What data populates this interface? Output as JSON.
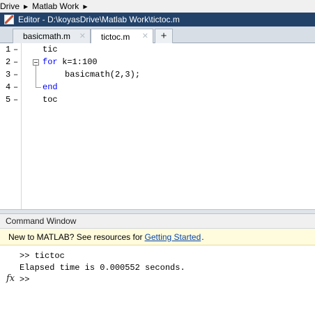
{
  "breadcrumb": {
    "items": [
      "Drive",
      "Matlab Work"
    ],
    "arrow": "▶"
  },
  "editor": {
    "title": "Editor - D:\\koyasDrive\\Matlab Work\\tictoc.m",
    "tabs": [
      {
        "label": "basicmath.m",
        "close": "✕"
      },
      {
        "label": "tictoc.m",
        "close": "✕"
      }
    ],
    "add_tab": "+",
    "lines": [
      {
        "number": "1",
        "marker": "–",
        "keyword": "",
        "text": "tic"
      },
      {
        "number": "2",
        "marker": "–",
        "keyword": "for",
        "text": " k=1:100"
      },
      {
        "number": "3",
        "marker": "–",
        "keyword": "",
        "text": "basicmath(2,3);"
      },
      {
        "number": "4",
        "marker": "–",
        "keyword": "end",
        "text": ""
      },
      {
        "number": "5",
        "marker": "–",
        "keyword": "",
        "text": "toc"
      }
    ]
  },
  "command_window": {
    "title": "Command Window",
    "notice": {
      "text": "New to MATLAB? See resources for",
      "link": "Getting Started",
      "period": "."
    },
    "output": [
      ">> tictoc",
      "Elapsed time is 0.000552 seconds.",
      ">>"
    ],
    "fx_label": "fx"
  },
  "icons": {
    "editor": "editor-icon",
    "fold": "fold-minus-icon",
    "fx": "function-browser-icon"
  },
  "colors": {
    "title_bar": "#22426a",
    "keyword": "#0000ff",
    "link": "#0645ad",
    "notice_bg": "#fffbdd"
  }
}
